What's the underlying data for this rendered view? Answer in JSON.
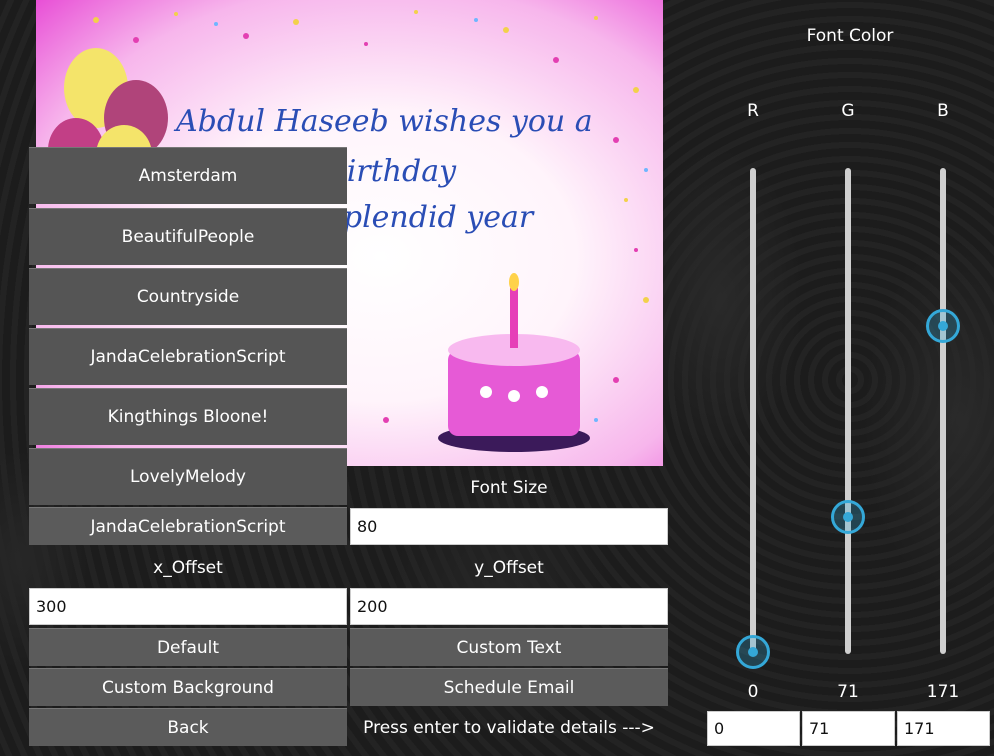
{
  "card": {
    "line1": "Abdul Haseeb wishes you a",
    "line2": "y birthday",
    "line3": "y splendid year"
  },
  "font_list": [
    "Amsterdam",
    "BeautifulPeople",
    "Countryside",
    "JandaCelebrationScript",
    "Kingthings Bloone!",
    "LovelyMelody"
  ],
  "font_select": {
    "selected": "JandaCelebrationScript"
  },
  "font_size": {
    "label": "Font Size",
    "value": "80"
  },
  "x_offset": {
    "label": "x_Offset",
    "value": "300"
  },
  "y_offset": {
    "label": "y_Offset",
    "value": "200"
  },
  "buttons": {
    "default": "Default",
    "custom_text": "Custom Text",
    "custom_background": "Custom Background",
    "schedule_email": "Schedule Email",
    "back": "Back"
  },
  "hint": "Press enter to validate details --->",
  "font_color": {
    "title": "Font Color",
    "r": {
      "label": "R",
      "value": 0,
      "display": "0",
      "input": "0"
    },
    "g": {
      "label": "G",
      "value": 71,
      "display": "71",
      "input": "71"
    },
    "b": {
      "label": "B",
      "value": 171,
      "display": "171",
      "input": "171"
    },
    "max": 255,
    "accent": "#34a8d8"
  }
}
